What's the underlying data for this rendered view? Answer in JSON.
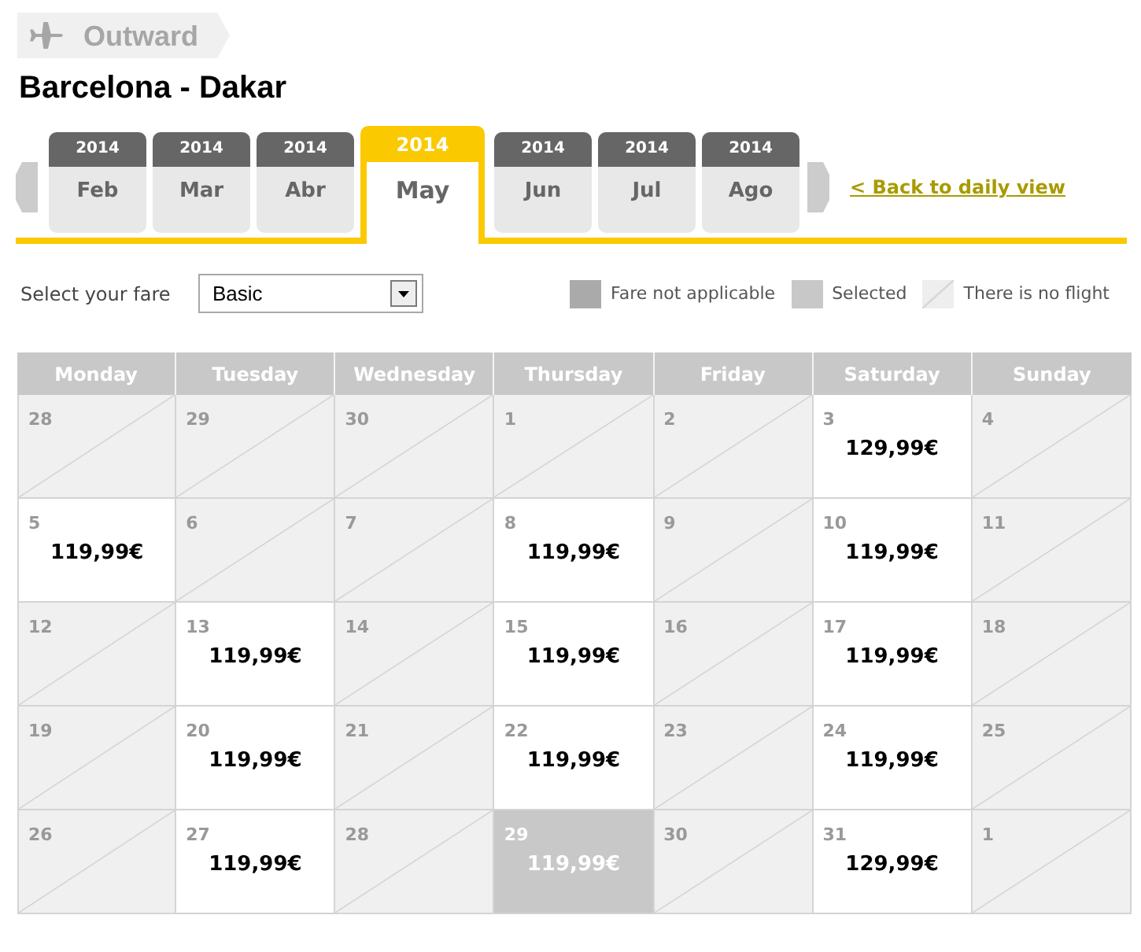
{
  "step_tab": {
    "label": "Outward"
  },
  "title": "Barcelona - Dakar",
  "month_tabs": [
    {
      "year": "2014",
      "month": "Feb",
      "selected": false
    },
    {
      "year": "2014",
      "month": "Mar",
      "selected": false
    },
    {
      "year": "2014",
      "month": "Abr",
      "selected": false
    },
    {
      "year": "2014",
      "month": "May",
      "selected": true
    },
    {
      "year": "2014",
      "month": "Jun",
      "selected": false
    },
    {
      "year": "2014",
      "month": "Jul",
      "selected": false
    },
    {
      "year": "2014",
      "month": "Ago",
      "selected": false
    }
  ],
  "back_link": "< Back to daily view",
  "fare_selector": {
    "label": "Select your fare",
    "value": "Basic"
  },
  "legend": [
    {
      "kind": "not_applicable",
      "label": "Fare not applicable"
    },
    {
      "kind": "selected",
      "label": "Selected"
    },
    {
      "kind": "no_flight",
      "label": "There is no flight"
    }
  ],
  "calendar": {
    "columns": [
      "Monday",
      "Tuesday",
      "Wednesday",
      "Thursday",
      "Friday",
      "Saturday",
      "Sunday"
    ],
    "weeks": [
      {
        "days": [
          {
            "day": "28",
            "kind": "no_flight",
            "selected": false
          },
          {
            "day": "29",
            "kind": "no_flight",
            "selected": false
          },
          {
            "day": "30",
            "kind": "no_flight",
            "selected": false
          },
          {
            "day": "1",
            "kind": "no_flight",
            "selected": false
          },
          {
            "day": "2",
            "kind": "no_flight",
            "selected": false
          },
          {
            "day": "3",
            "kind": "flight",
            "price": "129,99€",
            "selected": false
          },
          {
            "day": "4",
            "kind": "no_flight",
            "selected": false
          }
        ]
      },
      {
        "days": [
          {
            "day": "5",
            "kind": "flight",
            "price": "119,99€",
            "selected": false
          },
          {
            "day": "6",
            "kind": "no_flight",
            "selected": false
          },
          {
            "day": "7",
            "kind": "no_flight",
            "selected": false
          },
          {
            "day": "8",
            "kind": "flight",
            "price": "119,99€",
            "selected": false
          },
          {
            "day": "9",
            "kind": "no_flight",
            "selected": false
          },
          {
            "day": "10",
            "kind": "flight",
            "price": "119,99€",
            "selected": false
          },
          {
            "day": "11",
            "kind": "no_flight",
            "selected": false
          }
        ]
      },
      {
        "days": [
          {
            "day": "12",
            "kind": "no_flight",
            "selected": false
          },
          {
            "day": "13",
            "kind": "flight",
            "price": "119,99€",
            "selected": false
          },
          {
            "day": "14",
            "kind": "no_flight",
            "selected": false
          },
          {
            "day": "15",
            "kind": "flight",
            "price": "119,99€",
            "selected": false
          },
          {
            "day": "16",
            "kind": "no_flight",
            "selected": false
          },
          {
            "day": "17",
            "kind": "flight",
            "price": "119,99€",
            "selected": false
          },
          {
            "day": "18",
            "kind": "no_flight",
            "selected": false
          }
        ]
      },
      {
        "days": [
          {
            "day": "19",
            "kind": "no_flight",
            "selected": false
          },
          {
            "day": "20",
            "kind": "flight",
            "price": "119,99€",
            "selected": false
          },
          {
            "day": "21",
            "kind": "no_flight",
            "selected": false
          },
          {
            "day": "22",
            "kind": "flight",
            "price": "119,99€",
            "selected": false
          },
          {
            "day": "23",
            "kind": "no_flight",
            "selected": false
          },
          {
            "day": "24",
            "kind": "flight",
            "price": "119,99€",
            "selected": false
          },
          {
            "day": "25",
            "kind": "no_flight",
            "selected": false
          }
        ]
      },
      {
        "days": [
          {
            "day": "26",
            "kind": "no_flight",
            "selected": false
          },
          {
            "day": "27",
            "kind": "flight",
            "price": "119,99€",
            "selected": false
          },
          {
            "day": "28",
            "kind": "no_flight",
            "selected": false
          },
          {
            "day": "29",
            "kind": "flight",
            "price": "119,99€",
            "selected": true
          },
          {
            "day": "30",
            "kind": "no_flight",
            "selected": false
          },
          {
            "day": "31",
            "kind": "flight",
            "price": "129,99€",
            "selected": false
          },
          {
            "day": "1",
            "kind": "no_flight",
            "selected": false
          }
        ]
      }
    ]
  }
}
